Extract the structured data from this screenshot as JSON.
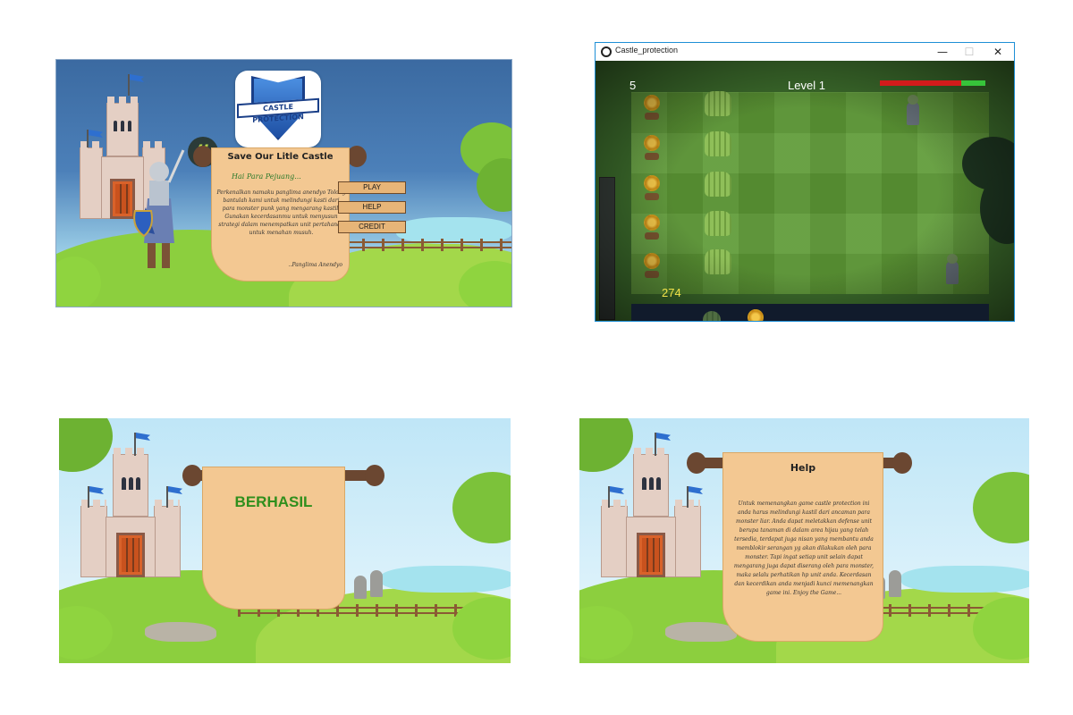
{
  "menu": {
    "logo_text": "CASTLE PROTECTION",
    "scroll_title": "Save Our Litle Castle",
    "greeting": "Hai Para Pejuang...",
    "body": "Perkenalkan namaku panglima anendyo Tolong bantulah kami untuk melindungi kasti dari para monster punk yang mengarang kastil. Gunakan kecerdasanmu untuk menyusun strategi dalam menempatkan unit pertahanan untuk menahan musuh.",
    "signature": "..Panglima Anendyo",
    "buttons": {
      "play": "PLAY",
      "help": "HELP",
      "credit": "CREDIT"
    },
    "quote_glyph": "❝"
  },
  "game": {
    "window_title": "Castle_protection",
    "window_buttons": {
      "minimize": "—",
      "maximize": "☐",
      "close": "✕"
    },
    "wave_count": "5",
    "level_label": "Level 1",
    "sun_count": "274",
    "castle_health": 0.23,
    "colors": {
      "health_bad": "#d21b1b",
      "health_good": "#37c43a",
      "accent": "#1e8fd6"
    }
  },
  "win": {
    "message": "BERHASIL"
  },
  "help": {
    "title": "Help",
    "body": "Untuk memenangkan game castle protection ini anda harus melindungi kastil dari ancaman para monster liar. Anda dapat meletakkan defense unit berupa tanaman di dalam area hijau yang telah tersedia, terdapat juga nisan yang membantu anda memblokir serangan yg akan dilakukan oleh para monster. Tapi ingat setiap unit selain dapat mengarang juga dapat diserang oleh para monster, maka selalu perhatikan hp unit anda. Kecerdasan dan kecerdikan anda menjadi kunci memenangkan game ini. Enjoy the Game..."
  }
}
